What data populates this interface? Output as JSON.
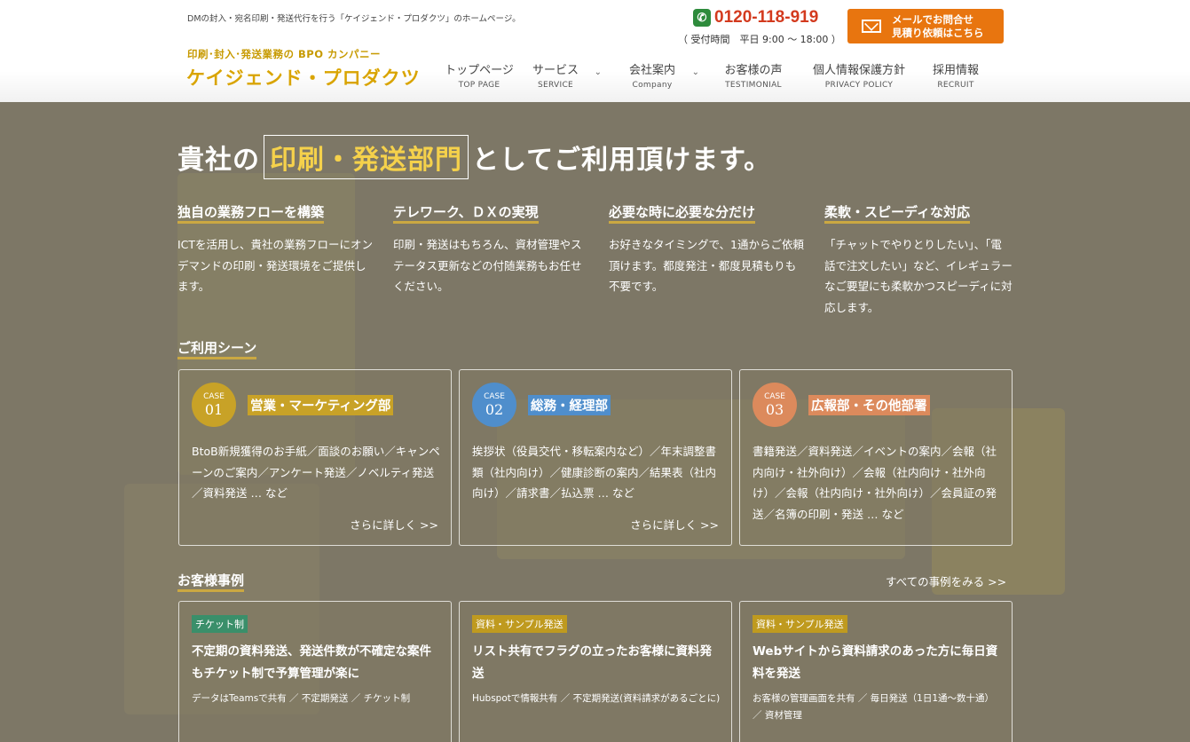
{
  "header": {
    "tagline": "DMの封入・宛名印刷・発送代行を行う「ケイジェンド・プロダクツ」のホームページ。",
    "brand_sub": "印刷･封入･発送業務の BPO カンパニー",
    "brand_name": "ケイジェンド・プロダクツ",
    "phone": "0120-118-919",
    "hours": "（ 受付時間　平日 9:00 ～ 18:00 ）",
    "mail_line1": "メールでお問合せ",
    "mail_line2": "見積り依頼はこちら"
  },
  "nav": [
    {
      "jp": "トップページ",
      "en": "TOP PAGE"
    },
    {
      "jp": "サービス",
      "en": "SERVICE"
    },
    {
      "jp": "会社案内",
      "en": "Company"
    },
    {
      "jp": "お客様の声",
      "en": "TESTIMONIAL"
    },
    {
      "jp": "個人情報保護方針",
      "en": "PRIVACY POLICY"
    },
    {
      "jp": "採用情報",
      "en": "RECRUIT"
    }
  ],
  "hero": {
    "title_pre": "貴社の",
    "title_highlight": "印刷・発送部門",
    "title_post": "としてご利用頂けます。"
  },
  "features": [
    {
      "title": "独自の業務フローを構築",
      "text": "ICTを活用し、貴社の業務フローにオンデマンドの印刷・発送環境をご提供します。"
    },
    {
      "title": "テレワーク、ＤＸの実現",
      "text": "印刷・発送はもちろん、資材管理やステータス更新などの付随業務もお任せください。"
    },
    {
      "title": "必要な時に必要な分だけ",
      "text": "お好きなタイミングで、1通からご依頼頂けます。都度発注・都度見積もりも不要です。"
    },
    {
      "title": "柔軟・スピーディな対応",
      "text": "「チャットでやりとりしたい」、「電話で注文したい」など、イレギュラーなご要望にも柔軟かつスピーディに対応します。"
    }
  ],
  "scenes": {
    "title": "ご利用シーン",
    "cases": [
      {
        "label": "CASE",
        "num": "01",
        "dept": "営業・マーケティング部",
        "color": "#c8a227",
        "text": "BtoB新規獲得のお手紙／面談のお願い／キャンペーンのご案内／アンケート発送／ノベルティ発送／資料発送 … など",
        "more": "さらに詳しく >>"
      },
      {
        "label": "CASE",
        "num": "02",
        "dept": "総務・経理部",
        "color": "#4f8ecc",
        "text": "挨拶状（役員交代・移転案内など）／年末調整書類（社内向け）／健康診断の案内／結果表（社内向け）／請求書／払込票 … など",
        "more": "さらに詳しく >>"
      },
      {
        "label": "CASE",
        "num": "03",
        "dept": "広報部・その他部署",
        "color": "#dc8a5c",
        "text": "書籍発送／資料発送／イベントの案内／会報（社内向け・社外向け）／会報（社内向け・社外向け）／会報（社内向け・社外向け）／会員証の発送／名簿の印刷・発送 … など",
        "more": ""
      }
    ]
  },
  "stories": {
    "title": "お客様事例",
    "all_link": "すべての事例をみる >>",
    "items": [
      {
        "tag": "チケット制",
        "tag_color": "#3a8f6a",
        "title": "不定期の資料発送、発送件数が不確定な案件もチケット制で予算管理が楽に",
        "meta": "データはTeamsで共有 ／ 不定期発送 ／ チケット制"
      },
      {
        "tag": "資料・サンプル発送",
        "tag_color": "#bf9a1f",
        "title": "リスト共有でフラグの立ったお客様に資料発送",
        "meta": "Hubspotで情報共有 ／ 不定期発送(資料請求があるごとに)"
      },
      {
        "tag": "資料・サンプル発送",
        "tag_color": "#bf9a1f",
        "title": "Webサイトから資料請求のあった方に毎日資料を発送",
        "meta": "お客様の管理画面を共有 ／ 毎日発送（1日1通～数十通） ／ 資材管理"
      }
    ]
  }
}
